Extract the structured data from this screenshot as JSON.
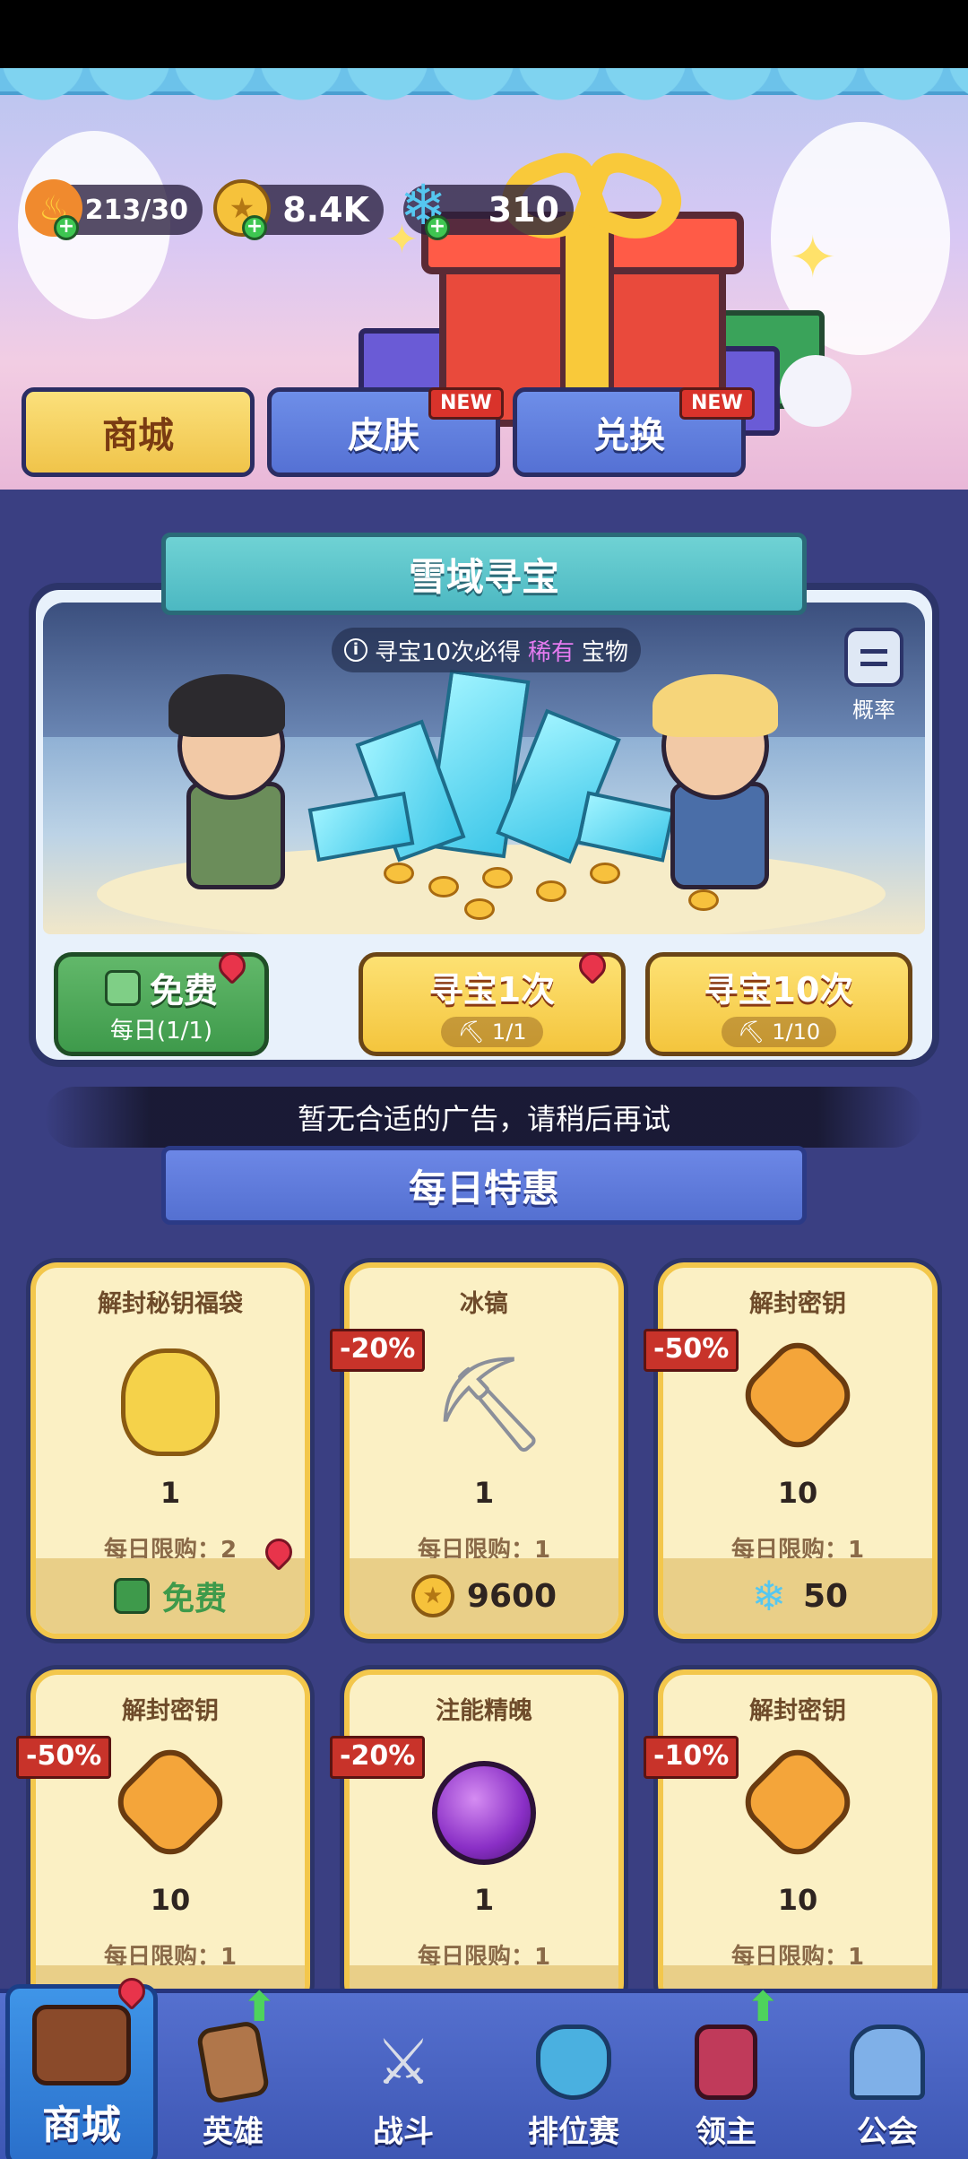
{
  "currencies": [
    {
      "name": "stamina",
      "icon": "flame-icon",
      "value": "213/30"
    },
    {
      "name": "gold",
      "icon": "gold-coin-icon",
      "value": "8.4K"
    },
    {
      "name": "gems",
      "icon": "ice-crystal-icon",
      "value": "310"
    }
  ],
  "shop_tabs": [
    {
      "label": "商城",
      "active": true,
      "badge": ""
    },
    {
      "label": "皮肤",
      "active": false,
      "badge": "NEW"
    },
    {
      "label": "兑换",
      "active": false,
      "badge": "NEW"
    }
  ],
  "treasure": {
    "title": "雪域寻宝",
    "hint_prefix": "寻宝10次必得",
    "hint_rare": "稀有",
    "hint_suffix": "宝物",
    "prob_label": "概率",
    "free_button": {
      "title": "免费",
      "sub": "每日(1/1)"
    },
    "single_button": {
      "title": "寻宝1次",
      "count": "1/1"
    },
    "ten_button": {
      "title": "寻宝10次",
      "count": "1/10"
    }
  },
  "ad_toast": "暂无合适的广告，请稍后再试",
  "daily": {
    "title": "每日特惠",
    "cards": [
      {
        "name": "解封秘钥福袋",
        "discount": "",
        "count": "1",
        "limit": "每日限购：2",
        "price": "免费",
        "price_icon": "video-icon",
        "item_icon": "lucky-bag-icon"
      },
      {
        "name": "冰镐",
        "discount": "-20%",
        "count": "1",
        "limit": "每日限购：1",
        "price": "9600",
        "price_icon": "gold-coin-icon",
        "item_icon": "pickaxe-icon"
      },
      {
        "name": "解封密钥",
        "discount": "-50%",
        "count": "10",
        "limit": "每日限购：1",
        "price": "50",
        "price_icon": "ice-crystal-icon",
        "item_icon": "key-icon"
      },
      {
        "name": "解封密钥",
        "discount": "-50%",
        "count": "10",
        "limit": "每日限购：1",
        "price": "",
        "price_icon": "",
        "item_icon": "key-icon"
      },
      {
        "name": "注能精魄",
        "discount": "-20%",
        "count": "1",
        "limit": "每日限购：1",
        "price": "",
        "price_icon": "",
        "item_icon": "purple-orb-icon"
      },
      {
        "name": "解封密钥",
        "discount": "-10%",
        "count": "10",
        "limit": "每日限购：1",
        "price": "",
        "price_icon": "",
        "item_icon": "key-icon"
      }
    ]
  },
  "bottom_nav": [
    {
      "label": "商城",
      "icon": "shop-icon",
      "active": true
    },
    {
      "label": "英雄",
      "icon": "hero-card-icon",
      "active": false
    },
    {
      "label": "战斗",
      "icon": "crossed-swords-icon",
      "active": false
    },
    {
      "label": "排位赛",
      "icon": "rank-shield-icon",
      "active": false
    },
    {
      "label": "领主",
      "icon": "lord-banner-icon",
      "active": false
    },
    {
      "label": "公会",
      "icon": "guild-castle-icon",
      "active": false
    }
  ],
  "colors": {
    "background": "#3a3f82",
    "accent_gold": "#f3c74c",
    "accent_teal": "#4cb8c2",
    "nav_blue": "#4a63c2",
    "discount_red": "#c8332a"
  }
}
